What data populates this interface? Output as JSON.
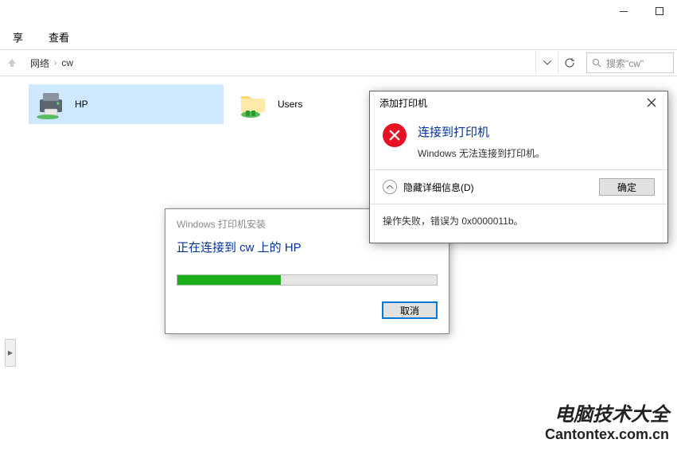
{
  "menu": {
    "share": "享",
    "view": "查看"
  },
  "breadcrumb": {
    "root": "网络",
    "current": "cw"
  },
  "search": {
    "placeholder": "搜索\"cw\""
  },
  "files": {
    "printer": "HP",
    "users_folder": "Users"
  },
  "progress_dialog": {
    "title": "Windows 打印机安装",
    "heading": "正在连接到 cw 上的 HP",
    "cancel": "取消",
    "progress_pct": 40
  },
  "error_dialog": {
    "title": "添加打印机",
    "heading": "连接到打印机",
    "message": "Windows 无法连接到打印机。",
    "details_toggle": "隐藏详细信息(D)",
    "ok": "确定",
    "error_detail": "操作失败，错误为 0x0000011b。"
  },
  "watermark": {
    "title": "电脑技术大全",
    "url": "Cantontex.com.cn"
  }
}
